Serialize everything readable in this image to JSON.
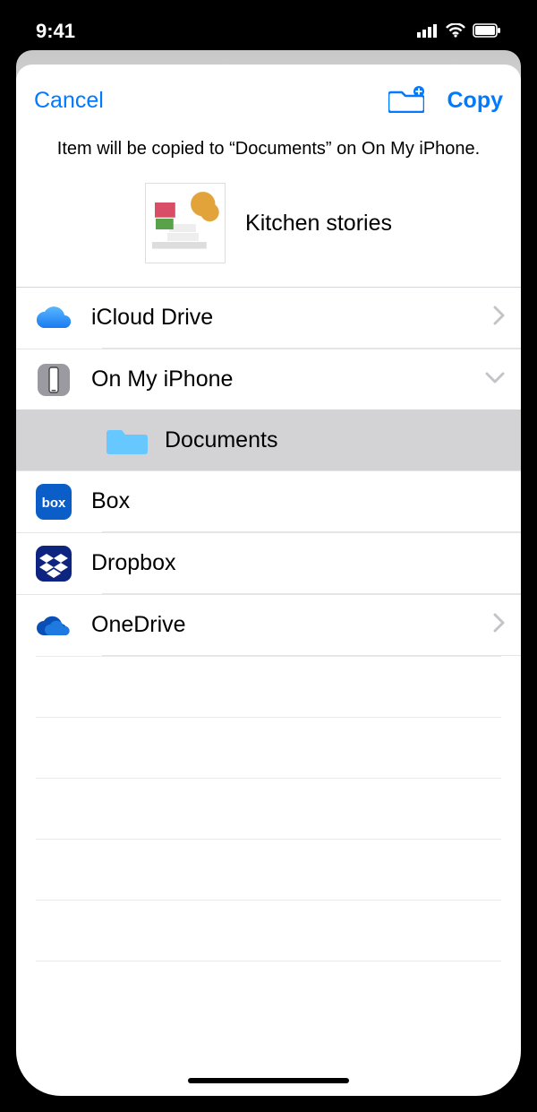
{
  "status": {
    "time": "9:41"
  },
  "nav": {
    "cancel": "Cancel",
    "copy": "Copy"
  },
  "subtitle": "Item will be copied to “Documents” on On My iPhone.",
  "item": {
    "title": "Kitchen stories"
  },
  "locations": [
    {
      "key": "icloud",
      "label": "iCloud Drive",
      "icon": "cloud-icon",
      "chevron": "right",
      "indent": 0
    },
    {
      "key": "onmy",
      "label": "On My iPhone",
      "icon": "phone-icon",
      "chevron": "down",
      "indent": 0
    },
    {
      "key": "docs",
      "label": "Documents",
      "icon": "folder-icon",
      "chevron": "",
      "indent": 1,
      "selected": true
    },
    {
      "key": "box",
      "label": "Box",
      "icon": "box-icon",
      "chevron": "",
      "indent": 0
    },
    {
      "key": "dropbox",
      "label": "Dropbox",
      "icon": "dropbox-icon",
      "chevron": "",
      "indent": 0
    },
    {
      "key": "onedrive",
      "label": "OneDrive",
      "icon": "onedrive-icon",
      "chevron": "right",
      "indent": 0
    }
  ]
}
